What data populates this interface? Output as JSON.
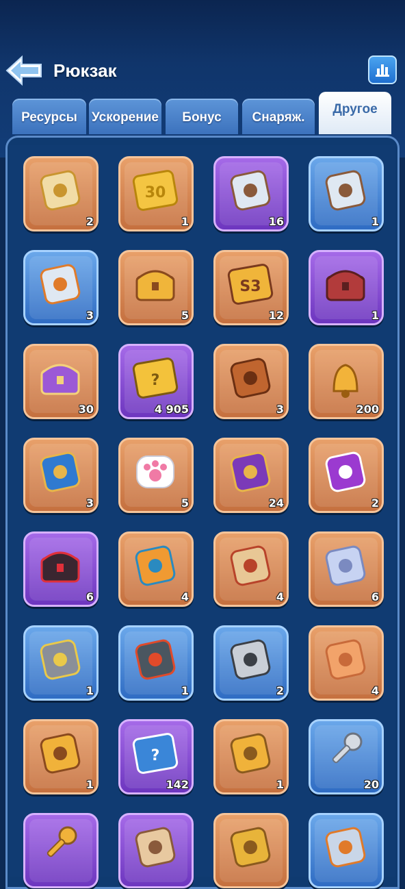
{
  "header": {
    "title": "Рюкзак",
    "back_icon": "back-arrow-icon",
    "stats_icon": "bar-chart-icon"
  },
  "tabs": [
    {
      "label": "Ресурсы",
      "active": false
    },
    {
      "label": "Ускорение",
      "active": false
    },
    {
      "label": "Бонус",
      "active": false
    },
    {
      "label": "Снаряж.",
      "active": false
    },
    {
      "label": "Другое",
      "active": true
    }
  ],
  "colors": {
    "orange_frame": "#d4804a",
    "blue_frame": "#3f7fd0",
    "purple_frame": "#8a4fd6",
    "background": "#103b72"
  },
  "items": [
    {
      "icon": "scroll-document-icon",
      "count": "2",
      "rarity": "orange"
    },
    {
      "icon": "ticket-30-icon",
      "count": "1",
      "rarity": "orange"
    },
    {
      "icon": "building-platform-icon",
      "count": "16",
      "rarity": "purple"
    },
    {
      "icon": "building-platform-icon",
      "count": "1",
      "rarity": "blue"
    },
    {
      "icon": "banner-platform-icon",
      "count": "3",
      "rarity": "blue"
    },
    {
      "icon": "treasure-chest-icon",
      "count": "5",
      "rarity": "orange"
    },
    {
      "icon": "s3-treasure-chest-icon",
      "count": "12",
      "rarity": "orange"
    },
    {
      "icon": "red-chest-icon",
      "count": "1",
      "rarity": "purple"
    },
    {
      "icon": "purple-crystal-icon",
      "count": "30",
      "rarity": "orange"
    },
    {
      "icon": "mystery-badge-icon",
      "count": "4 905",
      "rarity": "purple"
    },
    {
      "icon": "rocket-boots-icon",
      "count": "3",
      "rarity": "orange"
    },
    {
      "icon": "golden-bell-icon",
      "count": "200",
      "rarity": "orange"
    },
    {
      "icon": "snowflake-pendant-icon",
      "count": "3",
      "rarity": "orange"
    },
    {
      "icon": "paw-soap-icon",
      "count": "5",
      "rarity": "orange"
    },
    {
      "icon": "purple-card-icon",
      "count": "24",
      "rarity": "orange"
    },
    {
      "icon": "swap-ticket-icon",
      "count": "2",
      "rarity": "orange"
    },
    {
      "icon": "dark-ore-icon",
      "count": "6",
      "rarity": "purple"
    },
    {
      "icon": "orange-ticket-icon",
      "count": "4",
      "rarity": "orange"
    },
    {
      "icon": "treasure-map-icon",
      "count": "4",
      "rarity": "orange"
    },
    {
      "icon": "silver-shell-icon",
      "count": "6",
      "rarity": "orange"
    },
    {
      "icon": "cage-lamp-icon",
      "count": "1",
      "rarity": "blue"
    },
    {
      "icon": "robot-drone-icon",
      "count": "1",
      "rarity": "blue"
    },
    {
      "icon": "fishing-reel-icon",
      "count": "2",
      "rarity": "blue"
    },
    {
      "icon": "scales-ticket-icon",
      "count": "4",
      "rarity": "orange"
    },
    {
      "icon": "tractor-ticket-icon",
      "count": "1",
      "rarity": "orange"
    },
    {
      "icon": "mystery-card-icon",
      "count": "142",
      "rarity": "purple"
    },
    {
      "icon": "gold-ticket-icon",
      "count": "1",
      "rarity": "orange"
    },
    {
      "icon": "silver-key-icon",
      "count": "20",
      "rarity": "blue"
    },
    {
      "icon": "gold-key-icon",
      "count": "",
      "rarity": "purple"
    },
    {
      "icon": "id-card-icon",
      "count": "",
      "rarity": "purple"
    },
    {
      "icon": "gold-medal-icon",
      "count": "",
      "rarity": "orange"
    },
    {
      "icon": "crystal-pen-icon",
      "count": "",
      "rarity": "blue"
    }
  ]
}
